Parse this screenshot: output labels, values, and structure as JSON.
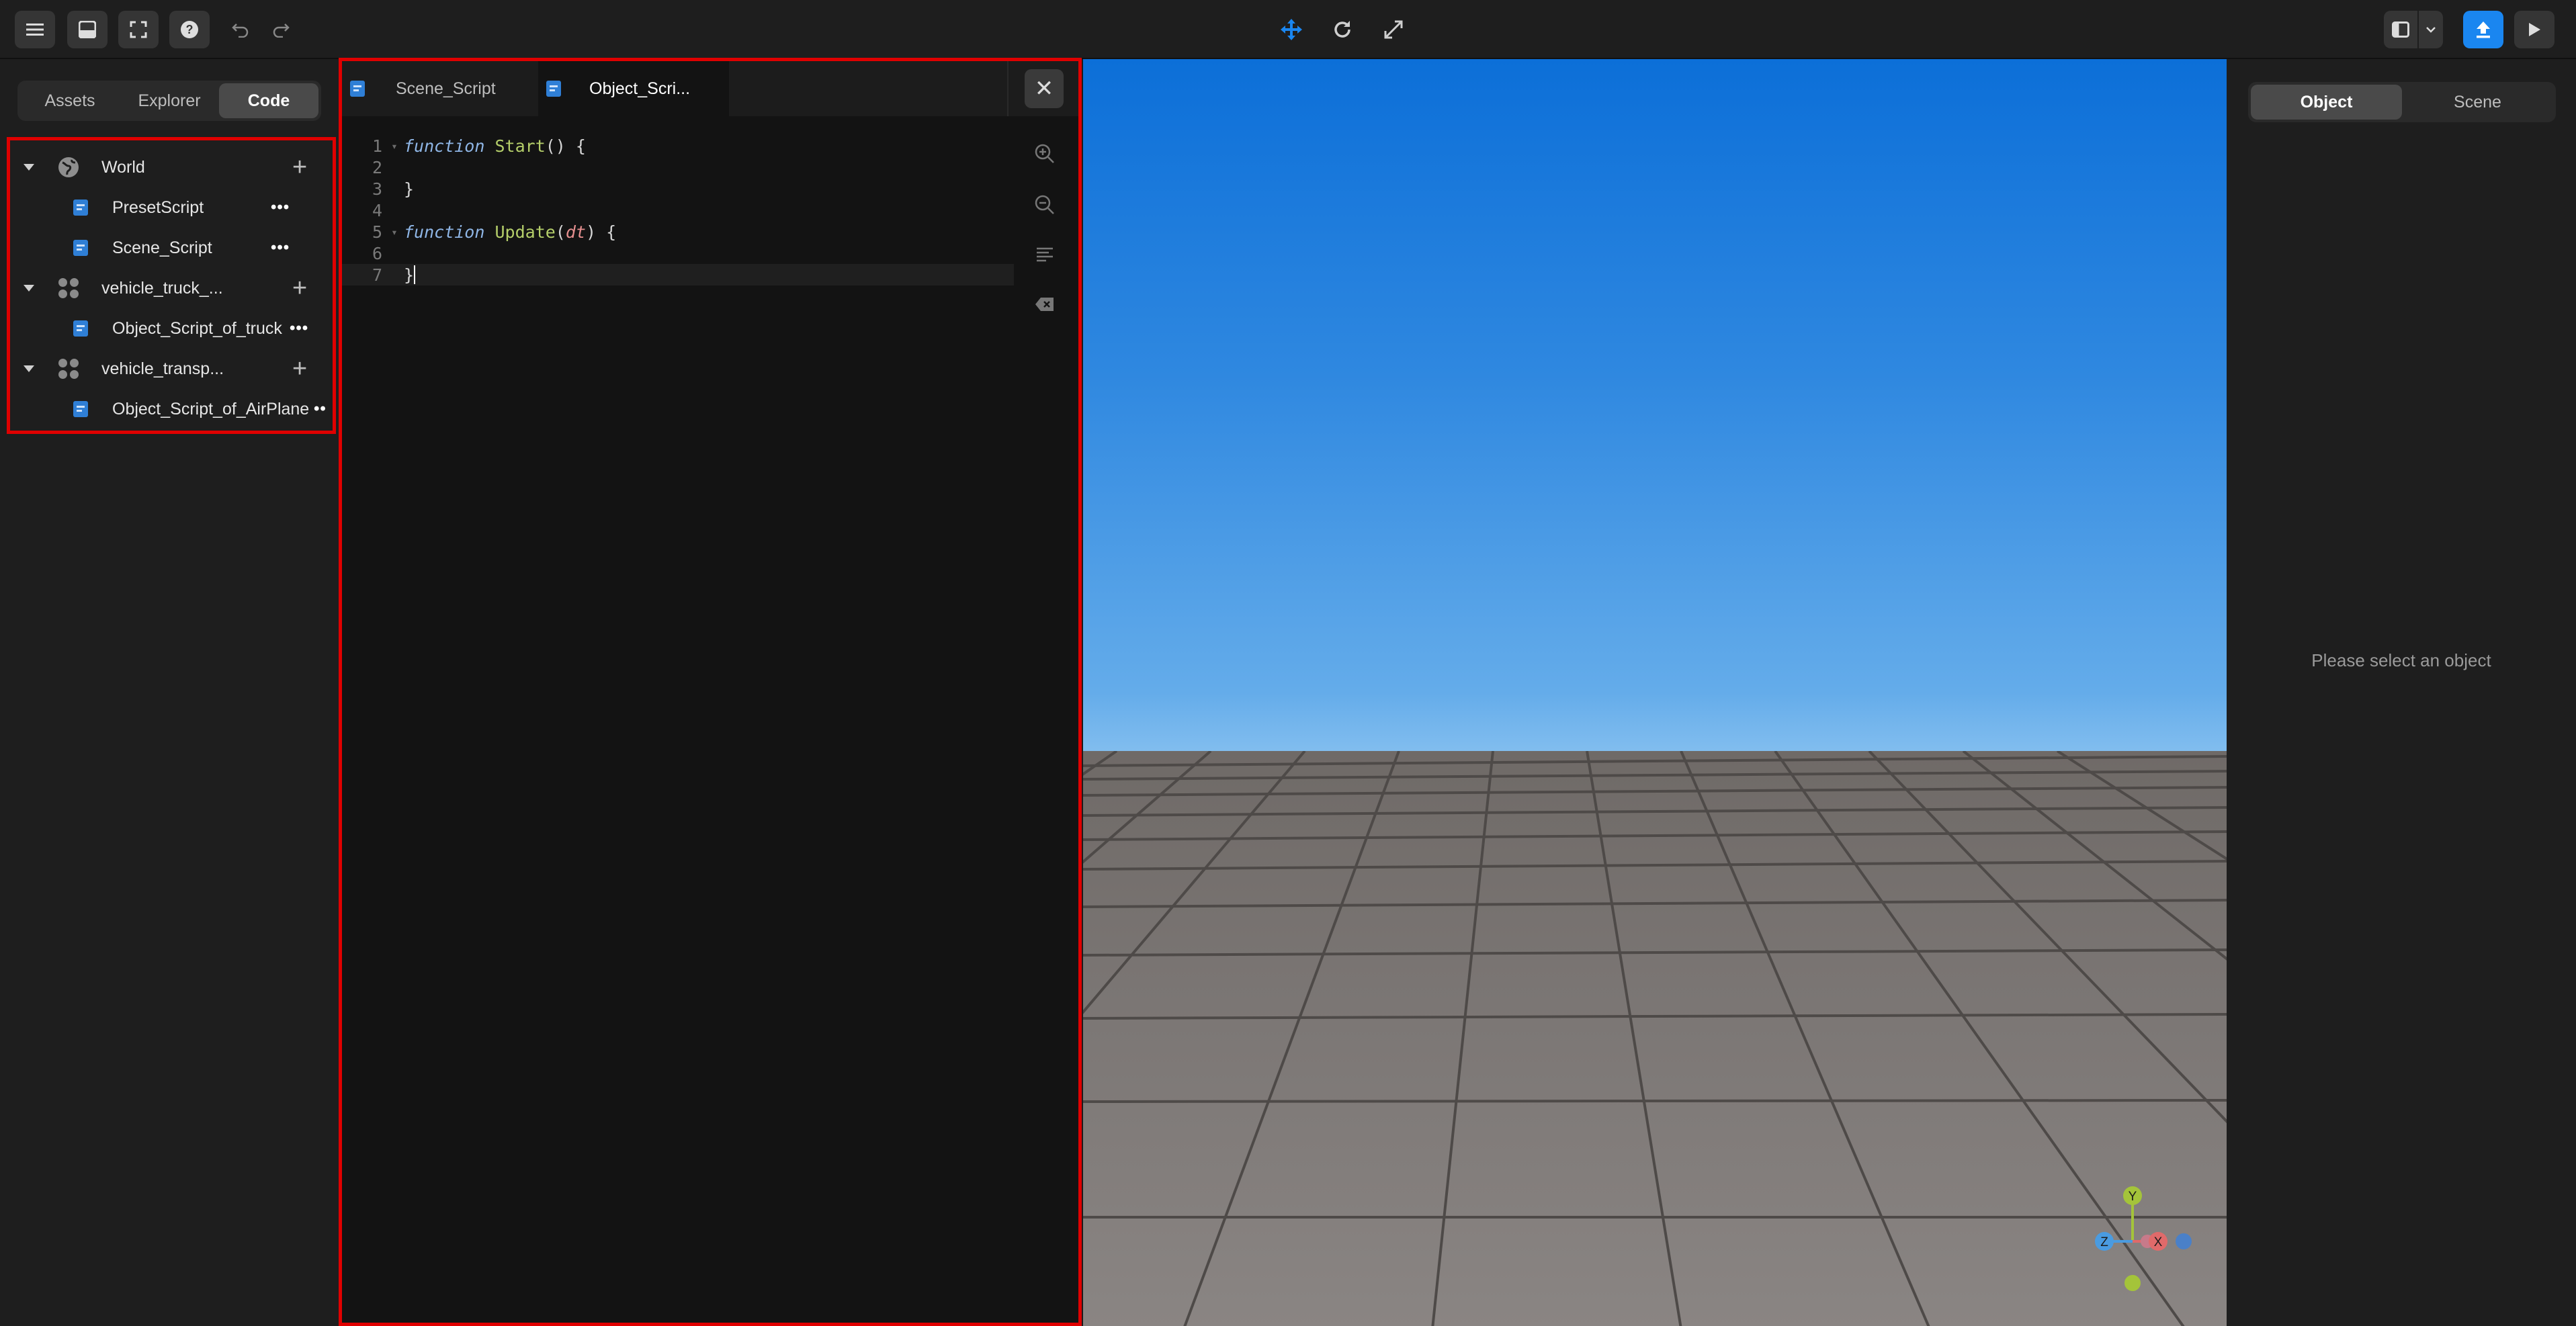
{
  "toolbar": {
    "left_icons": [
      "menu-icon",
      "inbox-icon",
      "fullscreen-icon",
      "help-icon",
      "undo-icon",
      "redo-icon"
    ],
    "center_icons": [
      "move-tool-icon",
      "rotate-tool-icon",
      "scale-tool-icon"
    ],
    "right_icons": [
      "layout-toggle-icon",
      "chevron-down-icon",
      "publish-icon",
      "play-icon"
    ],
    "accent": "#1a86f0"
  },
  "left_panel": {
    "tabs": [
      {
        "label": "Assets",
        "active": false
      },
      {
        "label": "Explorer",
        "active": false
      },
      {
        "label": "Code",
        "active": true
      }
    ],
    "tree": [
      {
        "label": "World",
        "type": "world",
        "level": 0,
        "has_add": true
      },
      {
        "label": "PresetScript",
        "type": "script",
        "level": 1,
        "more": "•••"
      },
      {
        "label": "Scene_Script",
        "type": "script",
        "level": 1,
        "more": "•••"
      },
      {
        "label": "vehicle_truck_...",
        "type": "group",
        "level": 0,
        "has_add": true
      },
      {
        "label": "Object_Script_of_truck",
        "type": "script",
        "level": 1,
        "more": "•••"
      },
      {
        "label": "vehicle_transp...",
        "type": "group",
        "level": 0,
        "has_add": true
      },
      {
        "label": "Object_Script_of_AirPlane",
        "type": "script",
        "level": 1,
        "more": "••"
      }
    ]
  },
  "editor": {
    "tabs": [
      {
        "label": "Scene_Script",
        "active": false
      },
      {
        "label": "Object_Scri...",
        "active": true
      }
    ],
    "close_label": "✕",
    "code_lines": [
      {
        "n": "1",
        "fold": true
      },
      {
        "n": "2"
      },
      {
        "n": "3",
        "text": "}"
      },
      {
        "n": "4"
      },
      {
        "n": "5",
        "fold": true
      },
      {
        "n": "6"
      },
      {
        "n": "7",
        "text": "}"
      }
    ],
    "line1": {
      "kw": "function",
      "fn": "Start",
      "rest": "() {"
    },
    "line5": {
      "kw": "function",
      "fn": "Update",
      "open": "(",
      "arg": "dt",
      "rest": ") {"
    },
    "side_tools": [
      "zoom-in-icon",
      "zoom-out-icon",
      "format-icon",
      "clear-icon"
    ]
  },
  "viewport": {
    "gizmo": {
      "y": "Y",
      "z": "Z",
      "x": "X"
    },
    "sky_top": "#0c6fd8",
    "floor_color": "#7a7573"
  },
  "right_panel": {
    "tabs": [
      {
        "label": "Object",
        "active": true
      },
      {
        "label": "Scene",
        "active": false
      }
    ],
    "empty_message": "Please select an object"
  }
}
